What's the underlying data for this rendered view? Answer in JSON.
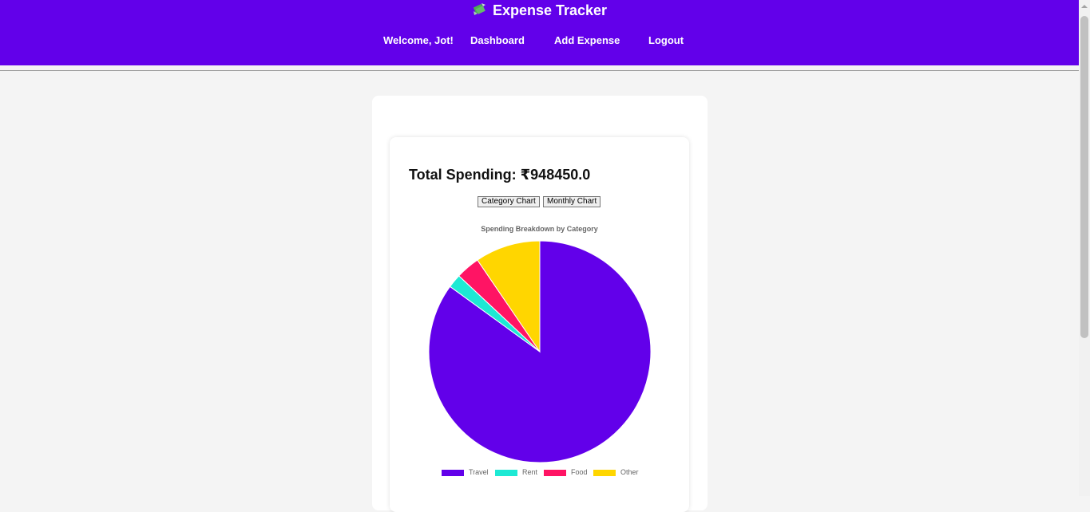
{
  "header": {
    "title": "Expense Tracker",
    "logo_icon": "money-with-wings-icon",
    "background": "#6200ea",
    "nav": [
      {
        "label": "Welcome, Jot!"
      },
      {
        "label": "Dashboard"
      },
      {
        "label": "Add Expense"
      },
      {
        "label": "Logout"
      }
    ]
  },
  "summary": {
    "total_label": "Total Spending: ₹948450.0"
  },
  "chart_buttons": {
    "category_label": "Category Chart",
    "monthly_label": "Monthly Chart"
  },
  "chart_data": {
    "type": "pie",
    "title": "Spending Breakdown by Category",
    "categories": [
      "Travel",
      "Rent",
      "Food",
      "Other"
    ],
    "values": [
      85,
      2,
      3.5,
      9.5
    ],
    "colors": [
      "#6200ea",
      "#1de9d4",
      "#ff1464",
      "#ffd600"
    ],
    "legend_position": "bottom"
  }
}
